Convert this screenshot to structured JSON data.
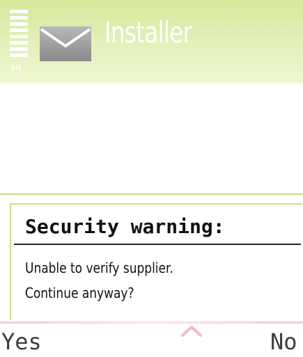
{
  "header": {
    "title": "Installer",
    "network_label": "3G",
    "signal_icon": "signal-strength-icon",
    "app_icon": "envelope-icon"
  },
  "dialog": {
    "title": "Security warning:",
    "message_line1": "Unable to verify supplier.",
    "message_line2": "Continue anyway?"
  },
  "softkeys": {
    "left_label": "Yes",
    "right_label": "No",
    "center_icon": "chevron-up-icon"
  },
  "colors": {
    "header_green": "#d4e89a",
    "accent_line": "#c8dd8f",
    "softkey_pink": "#f4c8d8",
    "text_dark": "#111111"
  }
}
